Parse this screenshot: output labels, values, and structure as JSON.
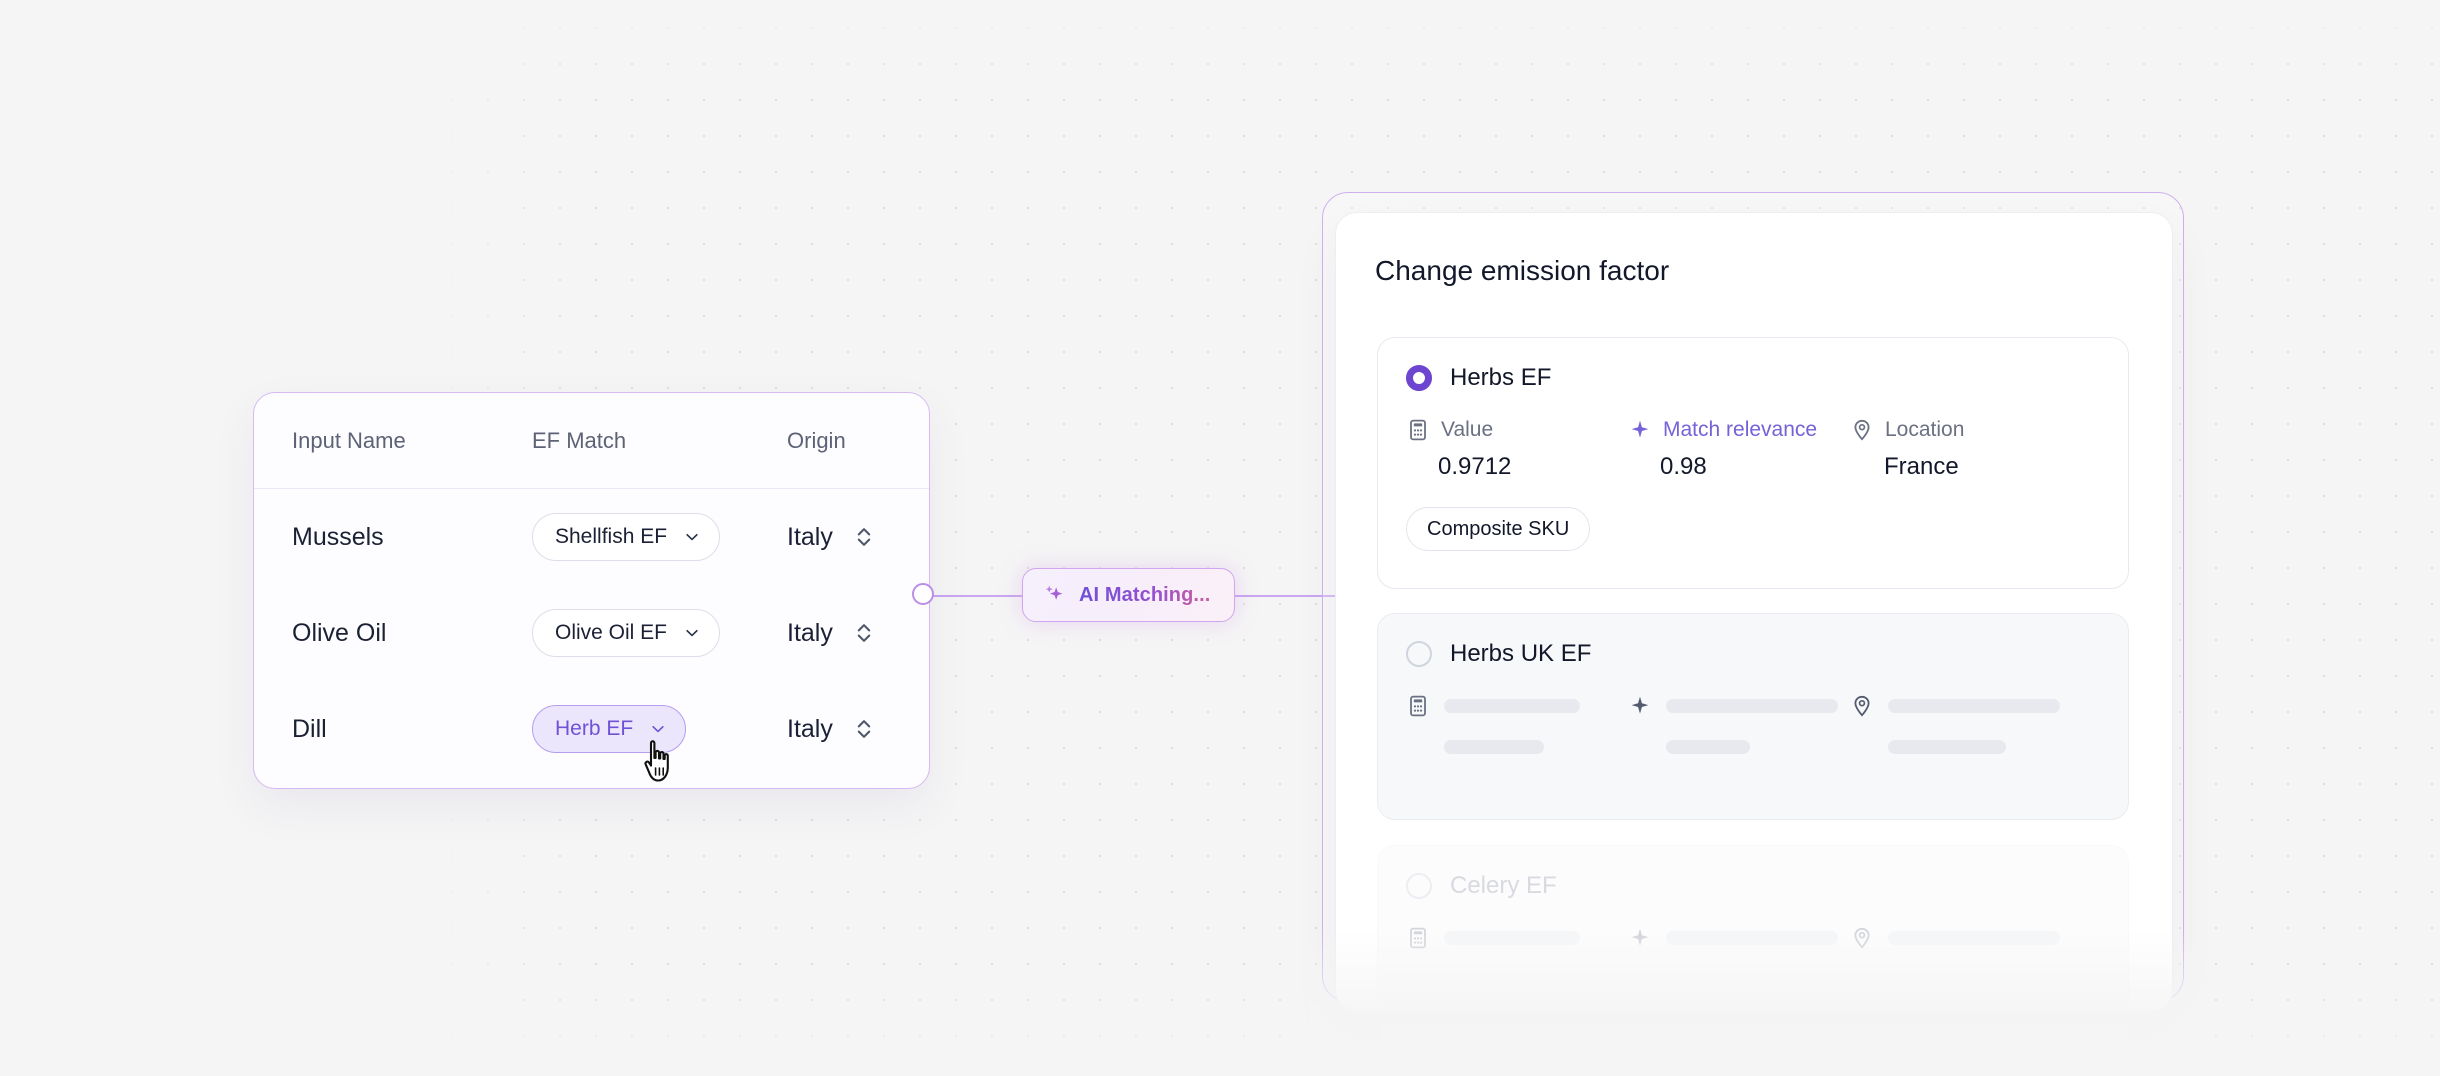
{
  "colors": {
    "accent_purple": "#6d45cf",
    "accent_light": "#c9a6ef",
    "pill_active_bg": "#ece6fd",
    "background": "#f5f5f5",
    "skeleton_grey": "#e7e9ef"
  },
  "connector": {
    "badge_label": "AI Matching...",
    "badge_icon": "sparkles-icon",
    "node_icon": "connector-node-icon"
  },
  "table": {
    "columns": [
      "Input Name",
      "EF Match",
      "Origin"
    ],
    "rows": [
      {
        "name": "Mussels",
        "match": "Shellfish EF",
        "match_active": false,
        "origin": "Italy"
      },
      {
        "name": "Olive Oil",
        "match": "Olive Oil EF",
        "match_active": false,
        "origin": "Italy"
      },
      {
        "name": "Dill",
        "match": "Herb EF",
        "match_active": true,
        "origin": "Italy"
      }
    ]
  },
  "panel": {
    "title": "Change emission factor",
    "cards": [
      {
        "name": "Herbs EF",
        "selected": true,
        "state": "loaded",
        "metrics": [
          {
            "icon": "calculator-icon",
            "label": "Value",
            "value": "0.9712",
            "accent": false
          },
          {
            "icon": "sparkle-icon",
            "label": "Match relevance",
            "value": "0.98",
            "accent": true
          },
          {
            "icon": "location-pin-icon",
            "label": "Location",
            "value": "France",
            "accent": false
          }
        ],
        "tag": "Composite SKU"
      },
      {
        "name": "Herbs UK EF",
        "selected": false,
        "state": "loading",
        "metrics": [
          {
            "icon": "calculator-icon",
            "label": "",
            "value": "",
            "accent": false
          },
          {
            "icon": "sparkle-icon",
            "label": "",
            "value": "",
            "accent": false
          },
          {
            "icon": "location-pin-icon",
            "label": "",
            "value": "",
            "accent": false
          }
        ],
        "tag": ""
      },
      {
        "name": "Celery EF",
        "selected": false,
        "state": "loading",
        "metrics": [
          {
            "icon": "calculator-icon",
            "label": "",
            "value": "",
            "accent": false
          },
          {
            "icon": "sparkle-icon",
            "label": "",
            "value": "",
            "accent": false
          },
          {
            "icon": "location-pin-icon",
            "label": "",
            "value": "",
            "accent": false
          }
        ],
        "tag": ""
      }
    ]
  },
  "cursor": {
    "type": "pointing-hand-cursor"
  }
}
